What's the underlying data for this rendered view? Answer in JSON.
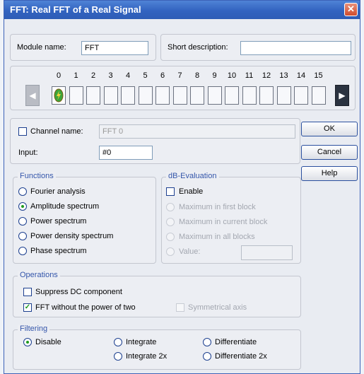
{
  "window": {
    "title": "FFT: Real FFT of a Real Signal"
  },
  "module": {
    "name_label": "Module name:",
    "name_value": "FFT",
    "short_desc_label": "Short description:",
    "short_desc_value": ""
  },
  "channels": {
    "numbers": [
      "0",
      "1",
      "2",
      "3",
      "4",
      "5",
      "6",
      "7",
      "8",
      "9",
      "10",
      "11",
      "12",
      "13",
      "14",
      "15"
    ]
  },
  "channel_name": {
    "label": "Channel name:",
    "value": "FFT 0",
    "checked": false
  },
  "input": {
    "label": "Input:",
    "value": "#0"
  },
  "buttons": {
    "ok": "OK",
    "cancel": "Cancel",
    "help": "Help"
  },
  "functions": {
    "title": "Functions",
    "options": [
      "Fourier analysis",
      "Amplitude spectrum",
      "Power spectrum",
      "Power density spectrum",
      "Phase spectrum"
    ],
    "selected": 1
  },
  "db": {
    "title": "dB-Evaluation",
    "enable_label": "Enable",
    "options": [
      "Maximum in first block",
      "Maximum in current block",
      "Maximum in all blocks",
      "Value:"
    ]
  },
  "operations": {
    "title": "Operations",
    "suppress_dc": "Suppress DC component",
    "fft_without_power": "FFT without the power of two",
    "symmetrical_axis": "Symmetrical axis"
  },
  "filtering": {
    "title": "Filtering",
    "disable": "Disable",
    "integrate": "Integrate",
    "integrate2x": "Integrate 2x",
    "differentiate": "Differentiate",
    "differentiate2x": "Differentiate 2x"
  }
}
